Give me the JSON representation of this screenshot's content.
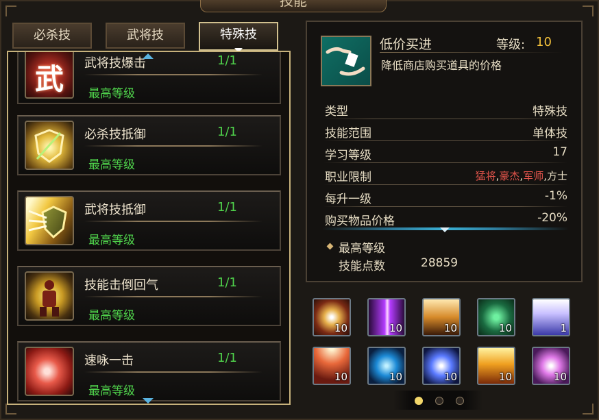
{
  "window": {
    "title": "技能"
  },
  "tabs": [
    {
      "label": "必杀技",
      "active": false
    },
    {
      "label": "武将技",
      "active": false
    },
    {
      "label": "特殊技",
      "active": true
    }
  ],
  "skills": [
    {
      "name": "武将技爆击",
      "level": "1/1",
      "status": "最高等级",
      "icon": "wu-character-icon",
      "icon_glyph": "武"
    },
    {
      "name": "必杀技抵御",
      "level": "1/1",
      "status": "最高等级",
      "icon": "golden-shield-icon"
    },
    {
      "name": "武将技抵御",
      "level": "1/1",
      "status": "最高等级",
      "icon": "radiant-shield-icon"
    },
    {
      "name": "技能击倒回气",
      "level": "1/1",
      "status": "最高等级",
      "icon": "warrior-aura-icon"
    },
    {
      "name": "速咏一击",
      "level": "1/1",
      "status": "最高等级",
      "icon": "red-burst-icon"
    }
  ],
  "detail": {
    "name": "低价买进",
    "level_label": "等级:",
    "level_value": "10",
    "description": "降低商店购买道具的价格",
    "icon": "card-exchange-icon",
    "stats": [
      {
        "key": "类型",
        "value": "特殊技"
      },
      {
        "key": "技能范围",
        "value": "单体技"
      },
      {
        "key": "学习等级",
        "value": "17"
      },
      {
        "key": "职业限制",
        "value_parts": [
          "猛将",
          ",",
          "豪杰",
          ",",
          "军师",
          ",方士"
        ]
      },
      {
        "key": "每升一级",
        "value": "-1%"
      },
      {
        "key": "购买物品价格",
        "value": "-20%"
      }
    ],
    "max_level": "最高等级",
    "points_label": "技能点数",
    "points_value": "28859"
  },
  "grid": [
    {
      "icon": "sword-spirit-icon",
      "count": "10"
    },
    {
      "icon": "purple-pillar-icon",
      "count": "10"
    },
    {
      "icon": "fire-spikes-icon",
      "count": "10"
    },
    {
      "icon": "gem-elements-icon",
      "count": "10"
    },
    {
      "icon": "dancing-figure-icon",
      "count": "1"
    },
    {
      "icon": "red-rays-icon",
      "count": "10"
    },
    {
      "icon": "blue-swirl-icon",
      "count": "10"
    },
    {
      "icon": "staff-sparkle-icon",
      "count": "10"
    },
    {
      "icon": "golden-flames-icon",
      "count": "10"
    },
    {
      "icon": "pink-explosion-icon",
      "count": "10"
    }
  ],
  "pagination": {
    "pages": 3,
    "current": 1
  },
  "colors": {
    "accent_green": "#4fd24b",
    "accent_yellow": "#f3c13b",
    "accent_red": "#e2544b",
    "gold_border": "#c7b27c"
  }
}
